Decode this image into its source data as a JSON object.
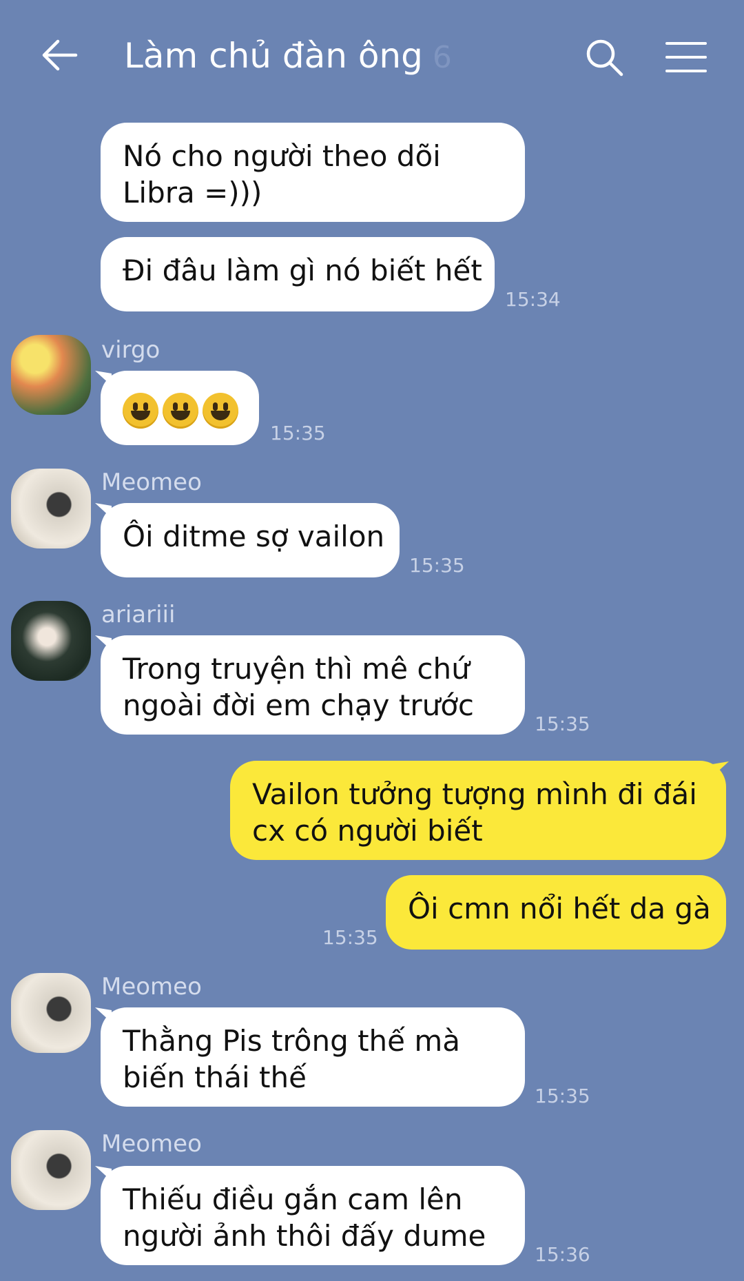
{
  "header": {
    "title": "Làm chủ đàn ông",
    "member_count": "6"
  },
  "messages": [
    {
      "sender": "",
      "direction": "in",
      "lines": [
        "Nó cho người theo dõi",
        "Libra =)))"
      ],
      "time": ""
    },
    {
      "sender": "",
      "direction": "in",
      "lines": [
        "Đi đâu làm gì nó biết hết"
      ],
      "time": "15:34"
    },
    {
      "sender": "virgo",
      "direction": "in",
      "emoji_count": 3,
      "time": "15:35"
    },
    {
      "sender": "Meomeo",
      "direction": "in",
      "lines": [
        "Ôi ditme sợ vailon"
      ],
      "time": "15:35"
    },
    {
      "sender": "ariariii",
      "direction": "in",
      "lines": [
        "Trong truyện thì mê chứ",
        "ngoài đời em chạy trước"
      ],
      "time": "15:35"
    },
    {
      "sender": "",
      "direction": "out",
      "lines": [
        "Vailon tưởng tượng mình đi đái",
        "cx có người biết"
      ],
      "time": ""
    },
    {
      "sender": "",
      "direction": "out",
      "lines": [
        "Ôi cmn nổi hết da gà"
      ],
      "time": "15:35"
    },
    {
      "sender": "Meomeo",
      "direction": "in",
      "lines": [
        "Thằng Pis trông thế mà",
        "biến thái thế"
      ],
      "time": "15:35"
    },
    {
      "sender": "Meomeo",
      "direction": "in",
      "lines": [
        "Thiếu điều gắn cam lên",
        "người ảnh thôi đấy dume"
      ],
      "time": "15:36"
    }
  ],
  "colors": {
    "background": "#6b84b3",
    "incoming_bubble": "#ffffff",
    "outgoing_bubble": "#fbe83a"
  },
  "icons": [
    "back-arrow-icon",
    "search-icon",
    "menu-icon",
    "smiley-emoji-icon"
  ]
}
